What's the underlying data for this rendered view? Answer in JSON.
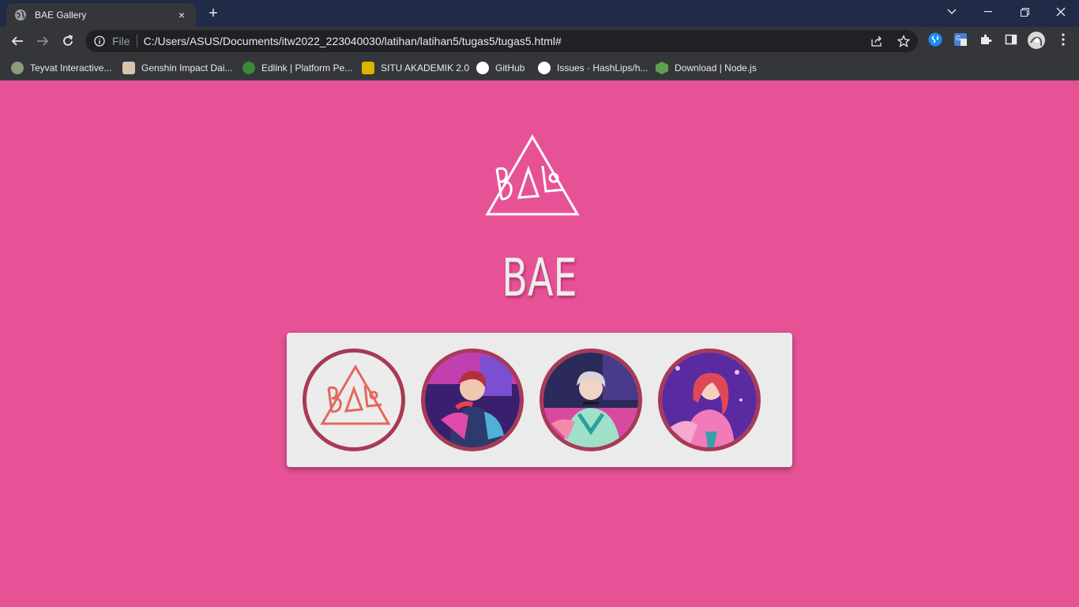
{
  "browser": {
    "tab": {
      "title": "BAE Gallery",
      "favicon": "globe-icon",
      "close": "×"
    },
    "new_tab": "+",
    "window_controls": {
      "minimize": "—",
      "restore": "❐",
      "close": "✕",
      "tabsearch": "⌄"
    },
    "address": {
      "scheme": "File",
      "url": "C:/Users/ASUS/Documents/itw2022_223040030/latihan/latihan5/tugas5/tugas5.html#"
    },
    "bookmarks": [
      {
        "label": "Teyvat Interactive...",
        "icon_color": "#8a9c7a"
      },
      {
        "label": "Genshin Impact Dai...",
        "icon_color": "#d8c2b0"
      },
      {
        "label": "Edlink | Platform Pe...",
        "icon_color": "#3a8a3a"
      },
      {
        "label": "SITU AKADEMIK 2.0",
        "icon_color": "#d9b400"
      },
      {
        "label": "GitHub",
        "icon_color": "#ffffff"
      },
      {
        "label": "Issues · HashLips/h...",
        "icon_color": "#ffffff"
      },
      {
        "label": "Download | Node.js",
        "icon_color": "#5fa04e"
      }
    ]
  },
  "page": {
    "heading": "BAE",
    "logo_text": "BAE",
    "colors": {
      "background": "#e75296",
      "card": "#ebebeb",
      "border": "#a83a55",
      "logo_accent": "#e2685e"
    },
    "gallery": [
      {
        "name": "BAE logo"
      },
      {
        "name": "member-1"
      },
      {
        "name": "member-2"
      },
      {
        "name": "member-3"
      }
    ]
  }
}
